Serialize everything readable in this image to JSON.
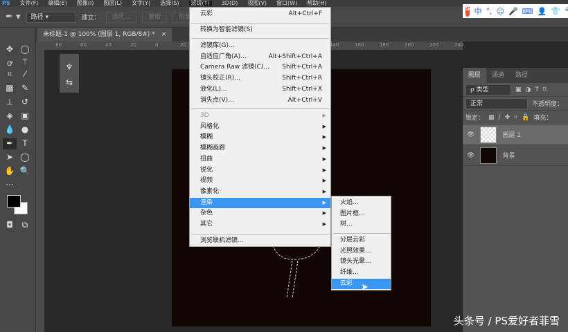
{
  "menubar": {
    "logo": "PS",
    "items": [
      "文件(F)",
      "编辑(E)",
      "图像(I)",
      "图层(L)",
      "文字(Y)",
      "选择(S)",
      "滤镜(T)",
      "3D(D)",
      "视图(V)",
      "窗口(W)",
      "帮助(H)"
    ]
  },
  "options": {
    "mode": "路径",
    "make_label": "建立：",
    "selection": "选区...",
    "mask": "蒙版",
    "shape": "形状"
  },
  "ime": {
    "logo": "S",
    "items": [
      "中",
      "°,",
      "☺",
      "🎤",
      "⌨",
      "👤",
      "👕",
      "🔧"
    ]
  },
  "document_tab": {
    "title": "未标题-1 @ 100% (图层 1, RGB/8#) *",
    "close": "×"
  },
  "ruler": [
    "80",
    "60",
    "40",
    "20",
    "0",
    "20",
    "40",
    "60",
    "80",
    "100",
    "120",
    "140",
    "160",
    "180",
    "200",
    "220",
    "240"
  ],
  "filter_menu": {
    "top": [
      {
        "label": "云彩",
        "shortcut": "Alt+Ctrl+F"
      },
      {
        "label": "转换为智能滤镜(S)"
      }
    ],
    "group1": [
      {
        "label": "滤镜库(G)..."
      },
      {
        "label": "自适应广角(A)...",
        "shortcut": "Alt+Shift+Ctrl+A"
      },
      {
        "label": "Camera Raw 滤镜(C)...",
        "shortcut": "Shift+Ctrl+A"
      },
      {
        "label": "镜头校正(R)...",
        "shortcut": "Shift+Ctrl+R"
      },
      {
        "label": "液化(L)...",
        "shortcut": "Shift+Ctrl+X"
      },
      {
        "label": "消失点(V)...",
        "shortcut": "Alt+Ctrl+V"
      }
    ],
    "group2": [
      "3D",
      "风格化",
      "模糊",
      "模糊画廊",
      "扭曲",
      "锐化",
      "视频",
      "像素化",
      "渲染",
      "杂色",
      "其它"
    ],
    "bottom": "浏览联机滤镜...",
    "highlighted": "渲染"
  },
  "render_submenu": {
    "group1": [
      "火焰...",
      "图片框...",
      "树..."
    ],
    "group2": [
      "分层云彩",
      "光照效果...",
      "镜头光晕...",
      "纤维...",
      "云彩"
    ],
    "highlighted": "云彩"
  },
  "layers_panel": {
    "tabs": [
      "图层",
      "通道",
      "路径"
    ],
    "filter": "ρ 类型",
    "blend": "正常",
    "opacity_label": "不透明度：",
    "lock_label": "锁定：",
    "fill_label": "填充：",
    "layers": [
      {
        "name": "图层 1",
        "selected": true
      },
      {
        "name": "背景",
        "selected": false
      }
    ]
  },
  "watermark": "头条号 / PS爱好者菲雪",
  "colors": {
    "highlight": "#3a96f0",
    "canvas": "#120605"
  }
}
